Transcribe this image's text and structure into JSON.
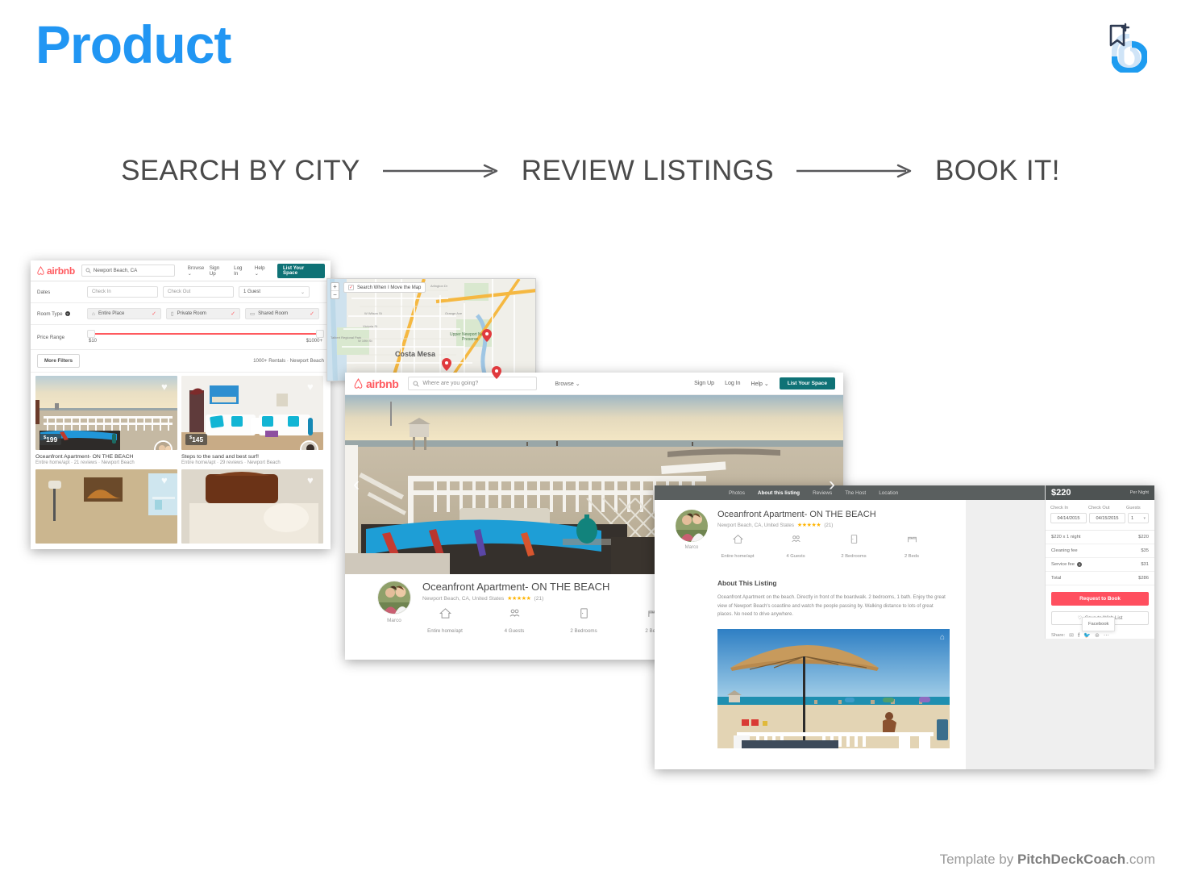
{
  "slide": {
    "title": "Product",
    "footer_prefix": "Template by ",
    "footer_brand": "PitchDeckCoach",
    "footer_suffix": ".com",
    "accent_blue": "#2196f3"
  },
  "flow": {
    "steps": [
      "SEARCH BY CITY",
      "REVIEW LISTINGS",
      "BOOK IT!"
    ]
  },
  "search_page": {
    "brand": "airbnb",
    "search_value": "Newport Beach, CA",
    "browse": "Browse",
    "nav": [
      "Sign Up",
      "Log In",
      "Help"
    ],
    "cta": "List Your Space",
    "dates_label": "Dates",
    "checkin_placeholder": "Check In",
    "checkout_placeholder": "Check Out",
    "guests_value": "1 Guest",
    "roomtype_label": "Room Type",
    "room_types": [
      "Entire Place",
      "Private Room",
      "Shared Room"
    ],
    "price_label": "Price Range",
    "price_min": "$10",
    "price_max": "$1000+",
    "more_filters": "More Filters",
    "result_count": "1000+ Rentals · Newport Beach",
    "listings": [
      {
        "price": "199",
        "title": "Oceanfront Apartment- ON THE BEACH",
        "meta": "Entire home/apt · 21 reviews · Newport Beach"
      },
      {
        "price": "145",
        "title": "Steps to the sand and best surf!",
        "meta": "Entire home/apt · 29 reviews · Newport Beach"
      }
    ],
    "map": {
      "move_checkbox": "Search When I Move the Map",
      "zoom_in": "+",
      "zoom_out": "−",
      "city": "Costa Mesa",
      "preserve": "Upper Newport Nature Preserve",
      "streets": [
        "W Wilson St",
        "Victoria St",
        "W 19th St",
        "Orange Ave",
        "Arlington Dr",
        "Fairview Rd"
      ],
      "park": "Talbert Regional Park"
    }
  },
  "listing_page": {
    "brand": "airbnb",
    "search_placeholder": "Where are you going?",
    "browse": "Browse",
    "nav": [
      "Sign Up",
      "Log In",
      "Help"
    ],
    "cta": "List Your Space",
    "title": "Oceanfront Apartment- ON THE BEACH",
    "location": "Newport Beach, CA, United States",
    "rating": "★★★★★",
    "review_count": "(21)",
    "host": "Marco",
    "features": [
      {
        "icon": "home-icon",
        "label": "Entire home/apt"
      },
      {
        "icon": "guests-icon",
        "label": "4 Guests"
      },
      {
        "icon": "bedroom-icon",
        "label": "2 Bedrooms"
      },
      {
        "icon": "bed-icon",
        "label": "2 Beds"
      }
    ]
  },
  "booking_page": {
    "tabs": [
      "Photos",
      "About this listing",
      "Reviews",
      "The Host",
      "Location"
    ],
    "active_tab": "About this listing",
    "title": "Oceanfront Apartment- ON THE BEACH",
    "location": "Newport Beach, CA, United States",
    "rating": "★★★★★",
    "review_count": "(21)",
    "host": "Marco",
    "features": [
      {
        "icon": "home-icon",
        "label": "Entire home/apt"
      },
      {
        "icon": "guests-icon",
        "label": "4 Guests"
      },
      {
        "icon": "bedroom-icon",
        "label": "2 Bedrooms"
      },
      {
        "icon": "bed-icon",
        "label": "2 Beds"
      }
    ],
    "about_heading": "About This Listing",
    "about_text": "Oceanfront Apartment on the beach. Directly in front of the boardwalk. 2 bedrooms, 1 bath. Enjoy the great view of Newport Beach's coastline and watch the people passing by. Walking distance to lots of great places. No need to drive anywhere.",
    "panel": {
      "price": "$220",
      "per_night": "Per Night",
      "checkin_label": "Check In",
      "checkout_label": "Check Out",
      "guests_label": "Guests",
      "checkin_value": "04/14/2015",
      "checkout_value": "04/15/2015",
      "guests_value": "1",
      "fees": [
        {
          "label": "$220 x 1 night",
          "value": "$220"
        },
        {
          "label": "Cleaning fee",
          "value": "$35"
        },
        {
          "label": "Service fee",
          "value": "$31"
        },
        {
          "label": "Total",
          "value": "$286"
        }
      ],
      "book_button": "Request to Book",
      "wish_button": "Save to Wish List",
      "facebook_tooltip": "Facebook",
      "share_label": "Share:",
      "share_icons": [
        "email-icon",
        "facebook-icon",
        "twitter-icon",
        "pinterest-icon",
        "more-icon"
      ],
      "accent": "#ff4f5f"
    }
  }
}
